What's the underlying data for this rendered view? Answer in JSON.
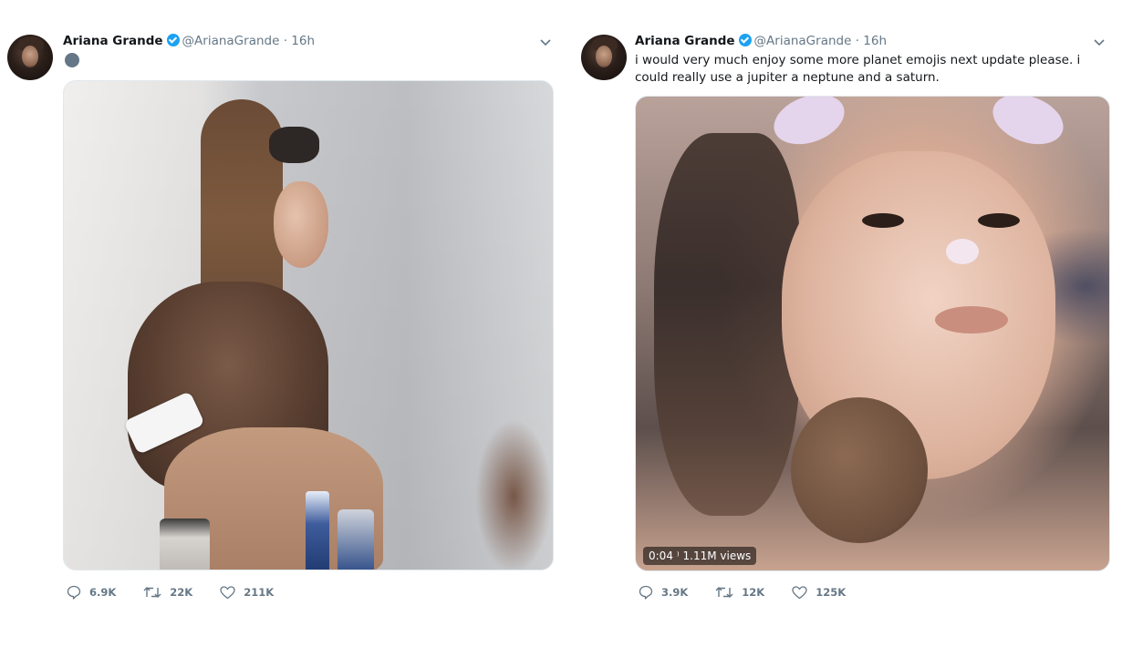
{
  "colors": {
    "accent": "#1da1f2",
    "secondary_text": "#657786",
    "primary_text": "#14171a"
  },
  "icons": [
    "verified-badge-icon",
    "chevron-down-icon",
    "reply-icon",
    "retweet-icon",
    "like-icon"
  ],
  "tweets": [
    {
      "author": {
        "name": "Ariana Grande",
        "handle": "@ArianaGrande",
        "time": "16h"
      },
      "meta": "@ArianaGrande · 16h",
      "text": "",
      "media": {
        "type": "photo",
        "badge": ""
      },
      "stats": {
        "replies": "6.9K",
        "retweets": "22K",
        "likes": "211K"
      }
    },
    {
      "author": {
        "name": "Ariana Grande",
        "handle": "@ArianaGrande",
        "time": "16h"
      },
      "meta": "@ArianaGrande · 16h",
      "text": "i would very much enjoy some more planet emojis next update please. i could really use a jupiter a neptune and a saturn.",
      "media": {
        "type": "video",
        "badge": "0:04 ⁾ 1.11M views"
      },
      "stats": {
        "replies": "3.9K",
        "retweets": "12K",
        "likes": "125K"
      }
    }
  ]
}
